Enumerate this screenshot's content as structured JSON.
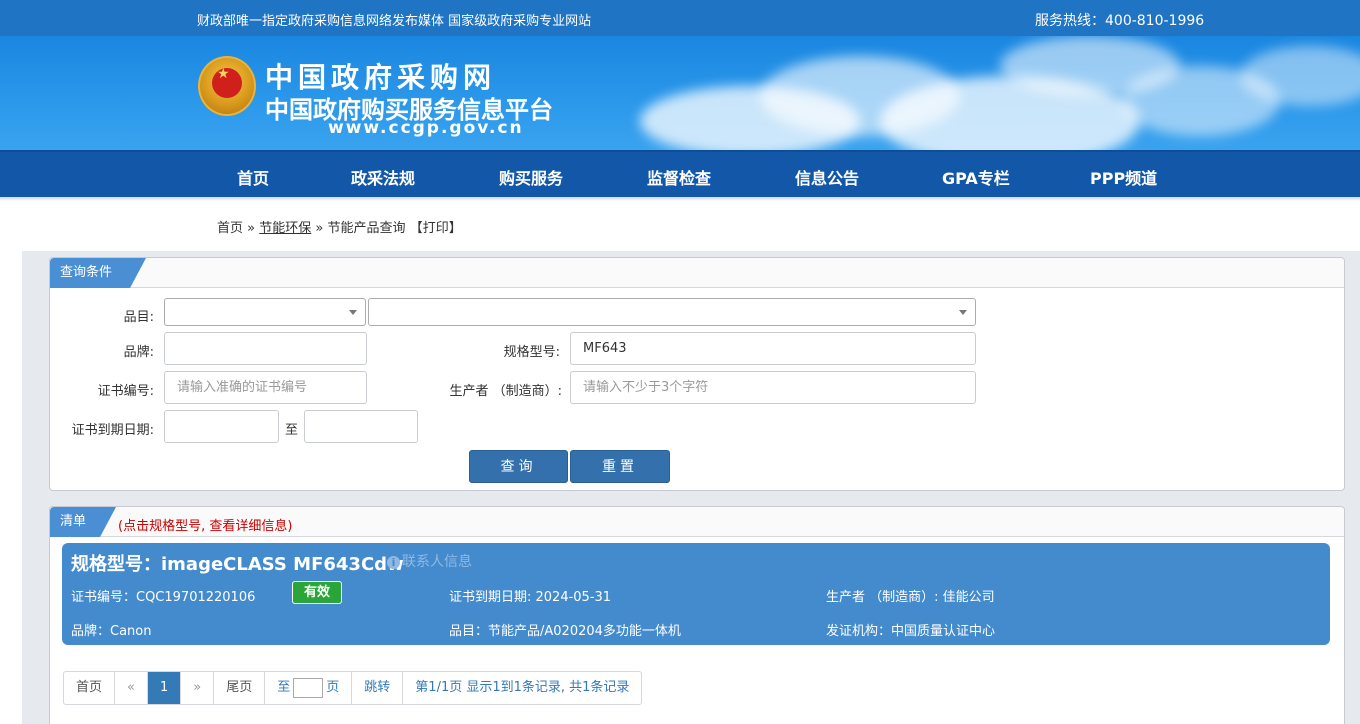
{
  "topbar": {
    "slogan": "财政部唯一指定政府采购信息网络发布媒体 国家级政府采购专业网站",
    "hotline": "服务热线：400-810-1996"
  },
  "logo": {
    "title": "中国政府采购网",
    "subtitle": "中国政府购买服务信息平台",
    "url": "www.ccgp.gov.cn"
  },
  "nav": {
    "items": [
      "首页",
      "政采法规",
      "购买服务",
      "监督检查",
      "信息公告",
      "GPA专栏",
      "PPP频道"
    ]
  },
  "breadcrumb": {
    "home": "首页",
    "sep1": "»",
    "section": "节能环保",
    "sep2": "»",
    "current": "节能产品查询",
    "print": "【打印】"
  },
  "query": {
    "tab": "查询条件",
    "category_label": "品目:",
    "brand_label": "品牌:",
    "brand_value": "",
    "model_label": "规格型号:",
    "model_value": "MF643",
    "cert_label": "证书编号:",
    "cert_placeholder": "请输入准确的证书编号",
    "maker_label": "生产者 （制造商）:",
    "maker_placeholder": "请输入不少于3个字符",
    "expire_label": "证书到期日期:",
    "to": "至",
    "search_btn": "查询",
    "reset_btn": "重置"
  },
  "list": {
    "tab": "清单",
    "hint": "(点击规格型号, 查看详细信息)",
    "hint_color": "#cc0000"
  },
  "result": {
    "title": "规格型号：imageCLASS MF643Cdw",
    "contact": "联系人信息",
    "cert_no": "证书编号：CQC19701220106",
    "status": "有效",
    "expire": "证书到期日期: 2024-05-31",
    "maker": "生产者 （制造商）: 佳能公司",
    "brand": "品牌：Canon",
    "category": "品目：节能产品/A020204多功能一体机",
    "issuer": "发证机构：中国质量认证中心"
  },
  "pager": {
    "first": "首页",
    "prev": "«",
    "page": "1",
    "next": "»",
    "last": "尾页",
    "goto_prefix": "至",
    "goto_suffix": "页",
    "jump": "跳转",
    "summary": "第1/1页  显示1到1条记录, 共1条记录"
  },
  "colors": {
    "topbar": "#1f74c4",
    "nav": "#1357a8",
    "card": "#448bcd",
    "valid_badge": "#2aa53a",
    "button": "#3470ac"
  }
}
